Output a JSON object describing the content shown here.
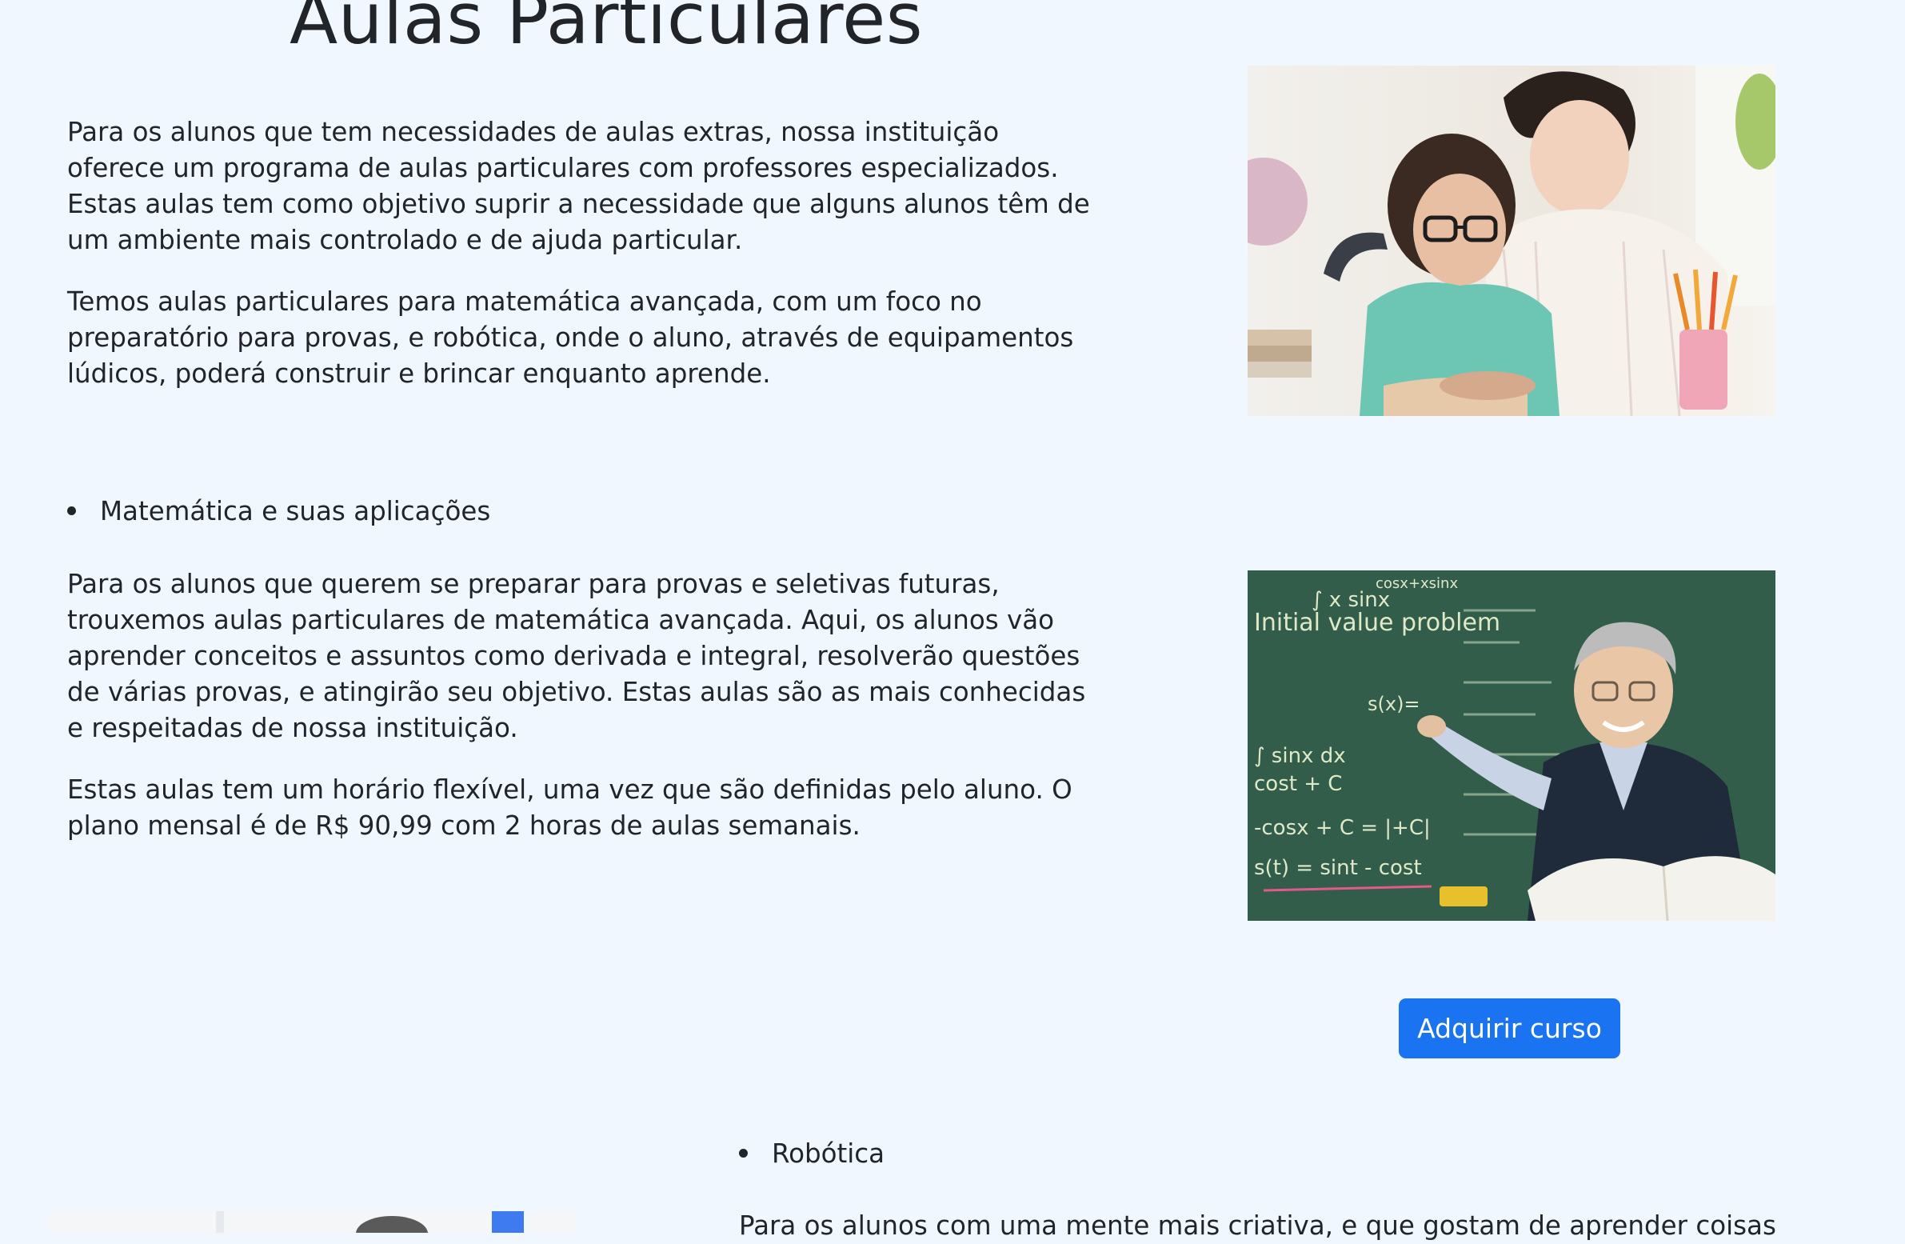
{
  "page": {
    "title": "Aulas Particulares"
  },
  "intro": {
    "paragraph1": "Para os alunos que tem necessidades de aulas extras, nossa instituição oferece um programa de aulas particulares com professores especializados. Estas aulas tem como objetivo suprir a necessidade que alguns alunos têm de um ambiente mais controlado e de ajuda particular.",
    "paragraph2": "Temos aulas particulares para matemática avançada, com um foco no preparatório para provas, e robótica, onde o aluno, através de equipamentos lúdicos, poderá construir e brincar enquanto aprende."
  },
  "math_section": {
    "bullet": "Matemática e suas aplicações",
    "paragraph1": "Para os alunos que querem se preparar para provas e seletivas futuras, trouxemos aulas particulares de matemática avançada. Aqui, os alunos vão aprender conceitos e assuntos como derivada e integral, resolverão questões de várias provas, e atingirão seu objetivo. Estas aulas são as mais conhecidas e respeitadas de nossa instituição.",
    "paragraph2": "Estas aulas tem um horário flexível, uma vez que são definidas pelo aluno. O plano mensal é de R$ 90,99 com 2 horas de aulas semanais.",
    "button_label": "Adquirir curso"
  },
  "robotics_section": {
    "bullet": "Robótica",
    "paragraph_partial": "Para os alunos com uma mente mais criativa, e que gostam de aprender coisas"
  },
  "blackboard": {
    "lines": [
      "∫ x sinx",
      "cosx+xsinx",
      "Initial value problem",
      "∫ sinx dx",
      "s(x)=",
      "cost + C",
      "-cosx + C = |+C|",
      "s(t) = sint - cost"
    ]
  },
  "colors": {
    "background": "#f0f7ff",
    "text": "#212529",
    "button": "#1a73f0",
    "button_text": "#ffffff"
  }
}
